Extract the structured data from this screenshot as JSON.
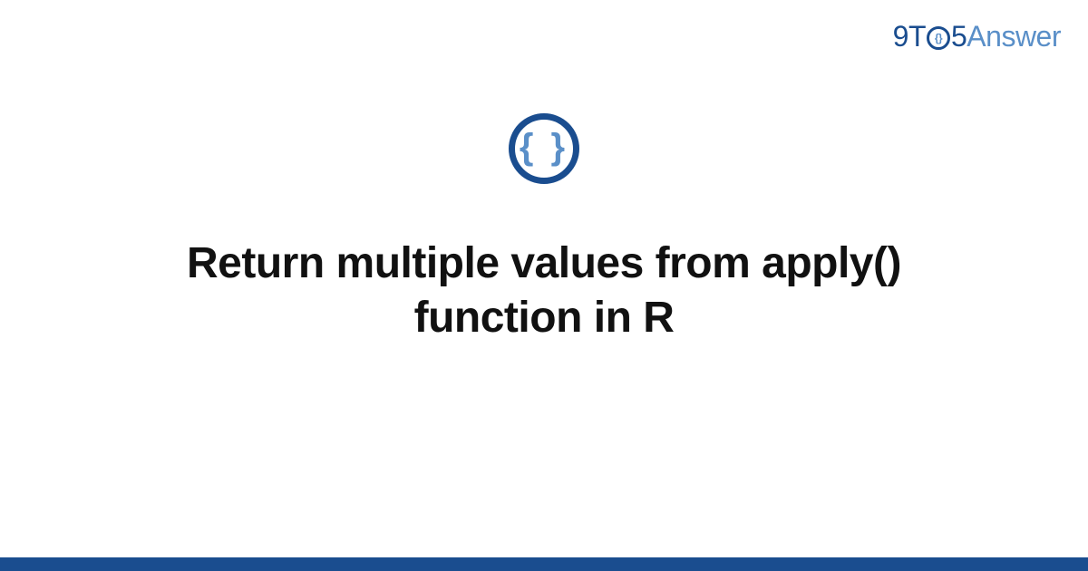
{
  "logo": {
    "part1": "9T",
    "circle_inner": "{}",
    "part2": "5",
    "part3": "Answer"
  },
  "icon": {
    "braces": "{ }"
  },
  "title": "Return multiple values from apply() function in R",
  "colors": {
    "primary": "#1a4d8f",
    "secondary": "#5a8fc8"
  }
}
